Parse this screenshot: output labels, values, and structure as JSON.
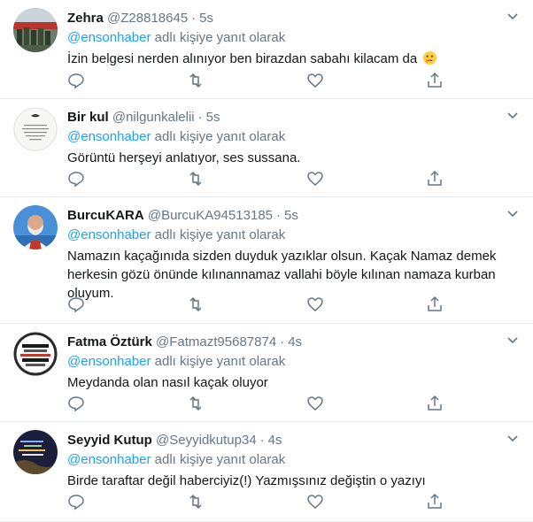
{
  "reply_prefix": "adlı kişiye yanıt olarak",
  "tweets": [
    {
      "name": "Zehra",
      "handle": "@Z28818645",
      "time": "5s",
      "reply_to": "@ensonhaber",
      "text": "İzin belgesi nerden alınıyor ben birazdan sabahı kilacam da",
      "emoji": "thinking-face-icon"
    },
    {
      "name": "Bir kul",
      "handle": "@nilgunkalelii",
      "time": "5s",
      "reply_to": "@ensonhaber",
      "text": "Görüntü herşeyi anlatıyor, ses sussana."
    },
    {
      "name": "BurcuKARA",
      "handle": "@BurcuKA94513185",
      "time": "5s",
      "reply_to": "@ensonhaber",
      "text": "Namazın kaçağınıda sizden duyduk yazıklar olsun. Kaçak Namaz demek herkesin gözü önünde kılınannamaz vallahi böyle kılınan namaza kurban oluyum."
    },
    {
      "name": "Fatma Öztürk",
      "handle": "@Fatmazt95687874",
      "time": "4s",
      "reply_to": "@ensonhaber",
      "text": "Meydanda olan nasıl kaçak oluyor"
    },
    {
      "name": "Seyyid Kutup",
      "handle": "@Seyyidkutup34",
      "time": "4s",
      "reply_to": "@ensonhaber",
      "text": "Birde taraftar değil haberciyiz(!) Yazmışsınız değiştin o yazıyı"
    }
  ],
  "colors": {
    "link": "#1da1f2",
    "muted": "#657786",
    "text": "#14171a",
    "divider": "#e6ecf0"
  }
}
